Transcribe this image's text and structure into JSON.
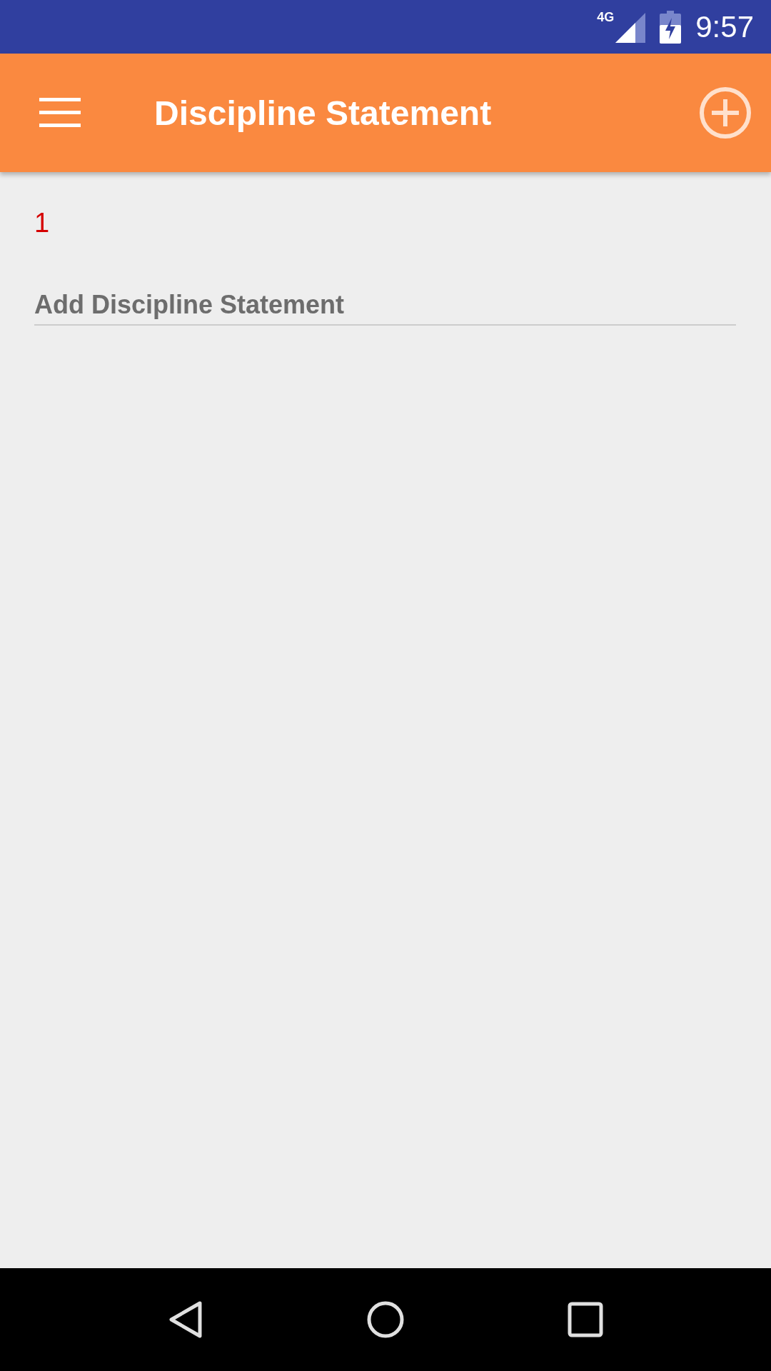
{
  "status_bar": {
    "network": "4G",
    "time": "9:57"
  },
  "app_bar": {
    "title": "Discipline Statement"
  },
  "counter": "1",
  "field": {
    "placeholder": "Add Discipline Statement"
  }
}
